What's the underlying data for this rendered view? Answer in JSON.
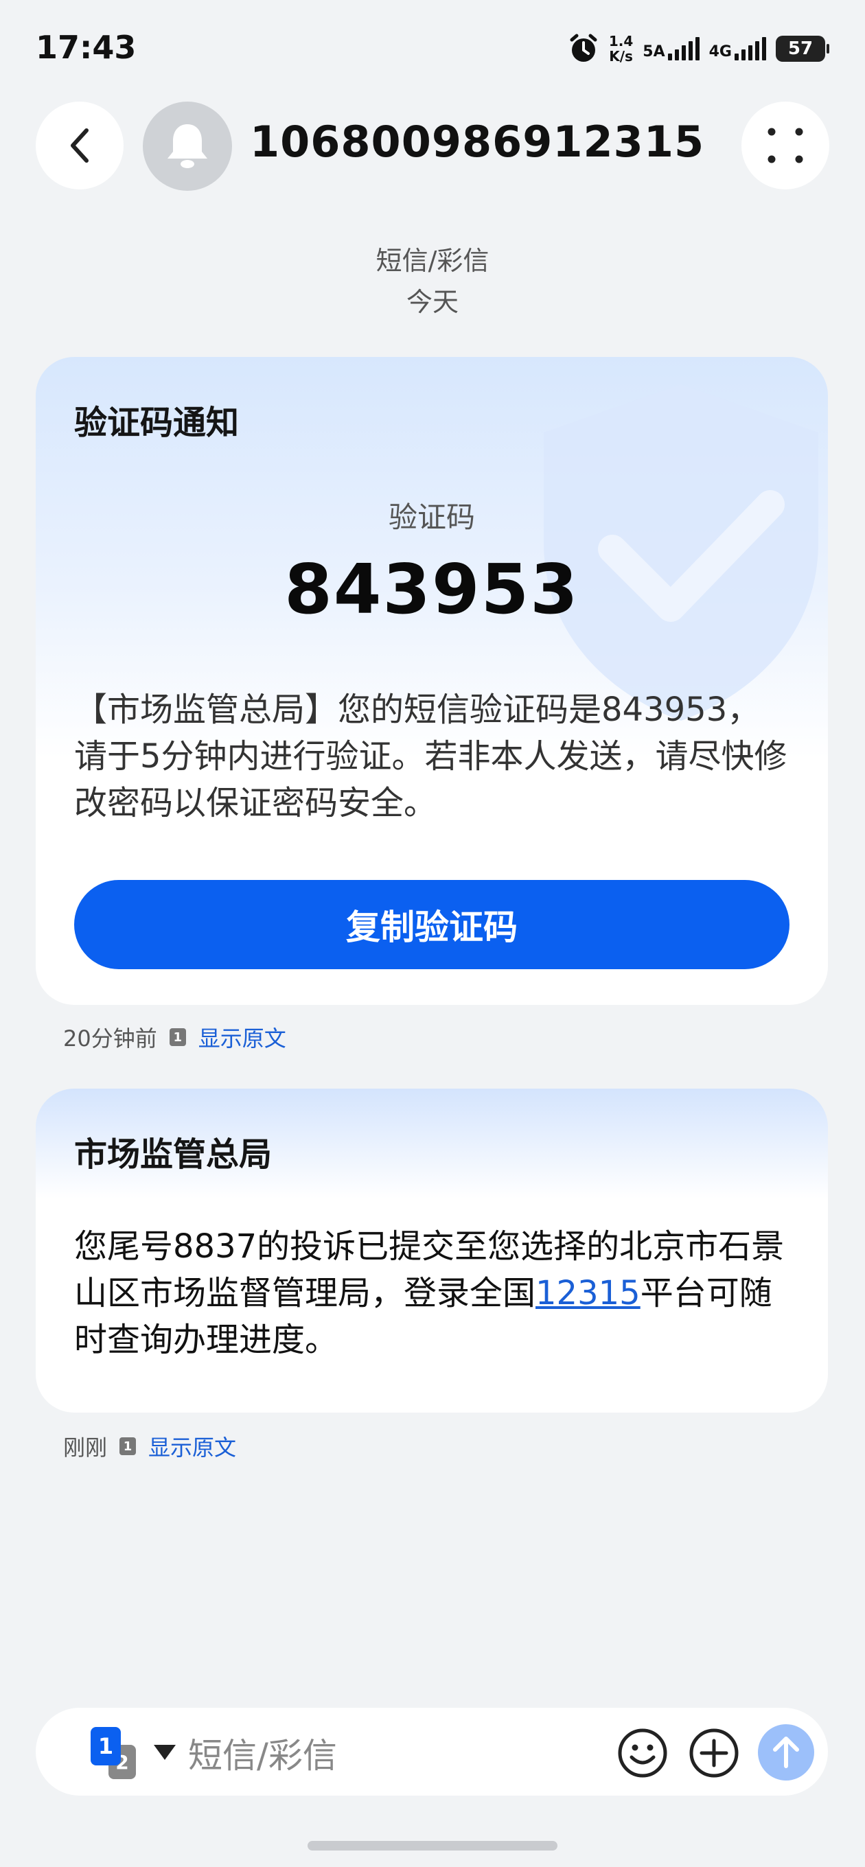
{
  "status_bar": {
    "time": "17:43",
    "speed_value": "1.4",
    "speed_unit": "K/s",
    "network1": "5A",
    "network2": "4G",
    "battery": "57"
  },
  "header": {
    "contact": "106800986912315",
    "back_icon": "chevron-left-icon",
    "avatar_icon": "bell-icon",
    "more_icon": "four-dots-icon"
  },
  "conversation": {
    "type": "短信/彩信",
    "date": "今天"
  },
  "messages": [
    {
      "card_title": "验证码通知",
      "code_label": "验证码",
      "code": "843953",
      "body": "【市场监管总局】您的短信验证码是843953，请于5分钟内进行验证。若非本人发送，请尽快修改密码以保证密码安全。",
      "button": "复制验证码",
      "time": "20分钟前",
      "sim": "1",
      "show_original": "显示原文"
    },
    {
      "card_title": "市场监管总局",
      "body_before": "您尾号8837的投诉已提交至您选择的北京市石景山区市场监督管理局，登录全国",
      "body_link": "12315",
      "body_after": "平台可随时查询办理进度。",
      "time": "刚刚",
      "sim": "1",
      "show_original": "显示原文"
    }
  ],
  "input_bar": {
    "sim_front": "1",
    "sim_back": "2",
    "placeholder": "短信/彩信"
  },
  "colors": {
    "accent": "#0b60f0",
    "link": "#1a5fd6",
    "background": "#f1f3f5",
    "send_disabled": "#9cc0fa"
  }
}
